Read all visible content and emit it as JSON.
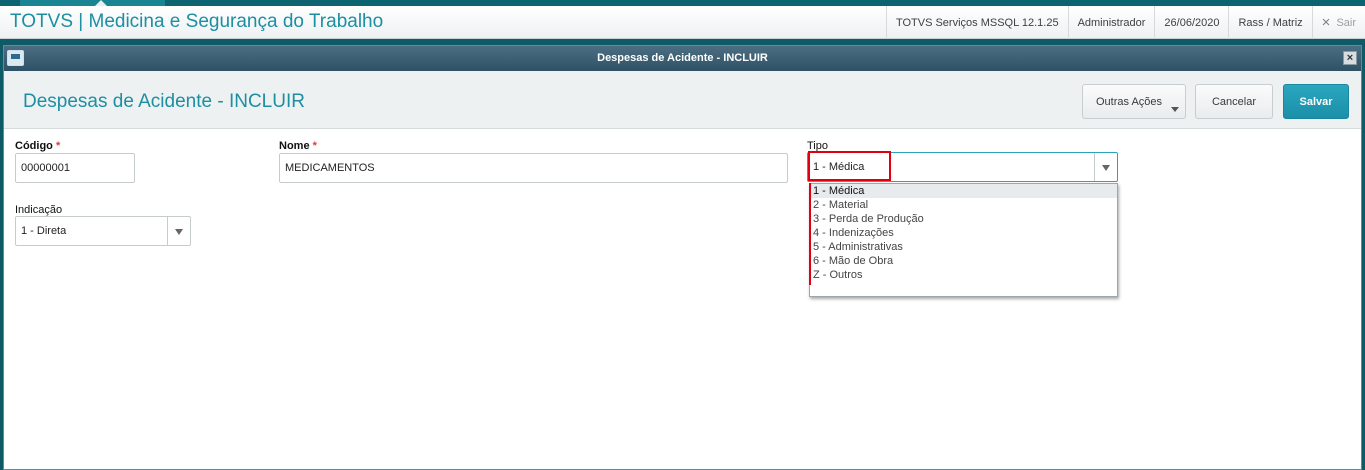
{
  "app": {
    "title": "TOTVS | Medicina e Segurança do Trabalho",
    "server": "TOTVS Serviços MSSQL 12.1.25",
    "user": "Administrador",
    "date": "26/06/2020",
    "branch": "Rass / Matriz",
    "exit_label": "Sair",
    "exit_icon": "×"
  },
  "dialog": {
    "window_title": "Despesas de Acidente - INCLUIR",
    "close_label": "×",
    "page_title": "Despesas de Acidente - INCLUIR",
    "buttons": {
      "more_actions": "Outras Ações",
      "cancel": "Cancelar",
      "save": "Salvar"
    }
  },
  "form": {
    "codigo": {
      "label": "Código",
      "required_mark": "*",
      "value": "00000001"
    },
    "nome": {
      "label": "Nome",
      "required_mark": "*",
      "value": "MEDICAMENTOS"
    },
    "tipo": {
      "label": "Tipo",
      "value": "1 - Médica",
      "options": [
        "1 - Médica",
        "2 - Material",
        "3 - Perda de Produção",
        "4 - Indenizações",
        "5 - Administrativas",
        "6 - Mão de Obra",
        "Z - Outros"
      ]
    },
    "indicacao": {
      "label": "Indicação",
      "value": "1 - Direta"
    }
  },
  "colors": {
    "accent": "#1c8fa3",
    "save_button": "#1b8fa8",
    "highlight": "#e0000f",
    "required": "#e53935"
  }
}
